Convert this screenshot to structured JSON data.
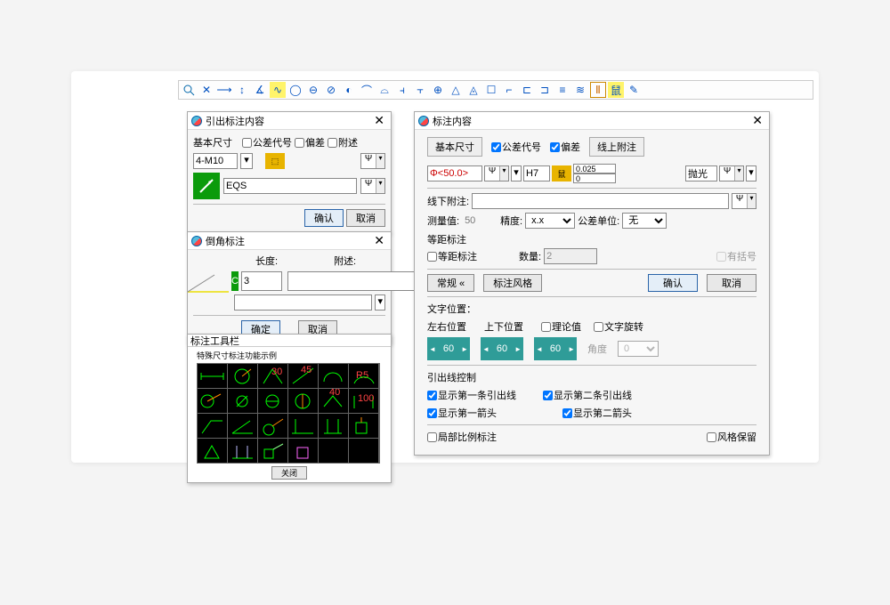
{
  "dlg1": {
    "title": "引出标注内容",
    "basic": "基本尺寸",
    "tolcode": "公差代号",
    "deviation": "偏差",
    "note": "附述",
    "val1": "4-M10",
    "eqs": "EQS",
    "ok": "确认",
    "cancel": "取消"
  },
  "dlg2": {
    "title": "倒角标注",
    "length": "长度:",
    "note": "附述:",
    "c": "C",
    "val": "3",
    "ok": "确定",
    "cancel": "取消"
  },
  "dlg3": {
    "title": "标注工具栏",
    "sub": "特殊尺寸标注功能示例",
    "close": "关闭"
  },
  "dlg4": {
    "title": "标注内容",
    "basic": "基本尺寸",
    "tolcode": "公差代号",
    "dev": "偏差",
    "upnote": "线上附注",
    "size": "Φ<50.0>",
    "h7": "H7",
    "devu": "0.025",
    "devl": "0",
    "polish": "抛光",
    "downnote": "线下附注:",
    "measv_l": "测量值:",
    "measv": "50",
    "prec_l": "精度:",
    "prec": "x.x",
    "tolunit_l": "公差单位:",
    "tolunit": "无",
    "eqd_head": "等距标注",
    "eqd": "等距标注",
    "qty_l": "数量:",
    "qty": "2",
    "paren": "有括号",
    "normal": "常规",
    "dstyle": "标注风格",
    "ok": "确认",
    "cancel": "取消",
    "txtpos": "文字位置：",
    "lr": "左右位置",
    "ud": "上下位置",
    "theory": "理论值",
    "txtrot": "文字旋转",
    "dimv": "60",
    "angle_l": "角度",
    "angle": "0",
    "leader": "引出线控制",
    "l1": "显示第一条引出线",
    "l2": "显示第二条引出线",
    "a1": "显示第一箭头",
    "a2": "显示第二箭头",
    "loc": "局部比例标注",
    "keep": "风格保留"
  }
}
